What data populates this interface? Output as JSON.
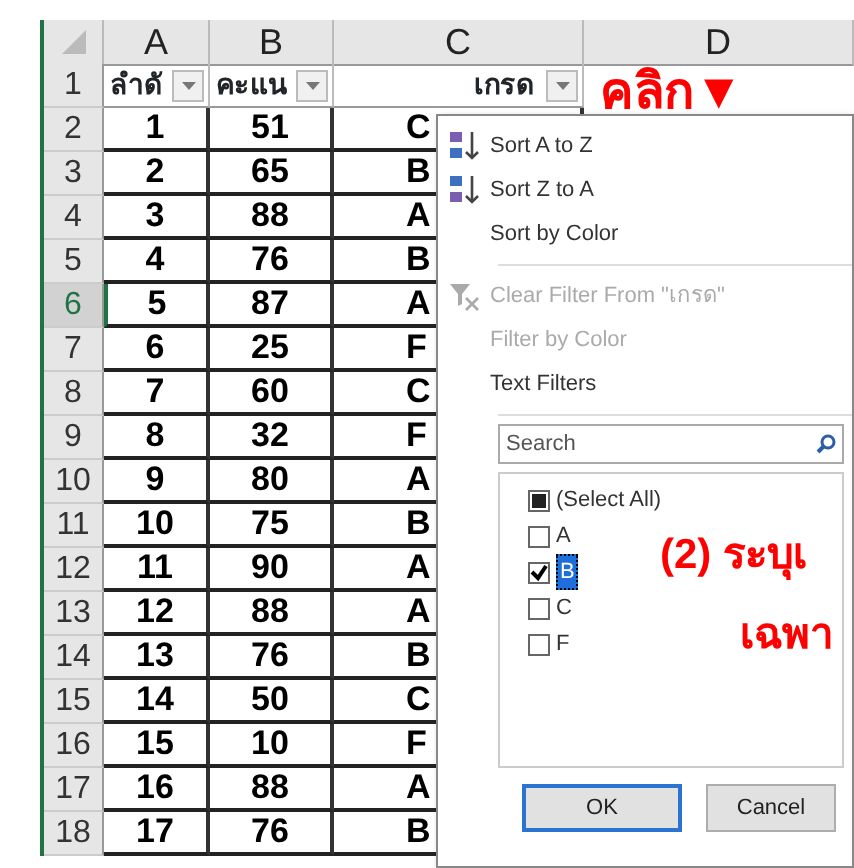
{
  "columns": [
    "A",
    "B",
    "C",
    "D"
  ],
  "header_row": {
    "number": "1",
    "cells": [
      "ลำดั",
      "คะแน",
      "เกรด"
    ]
  },
  "rows": [
    {
      "number": "2",
      "cells": [
        "1",
        "51",
        "C"
      ],
      "selected": false
    },
    {
      "number": "3",
      "cells": [
        "2",
        "65",
        "B"
      ],
      "selected": false
    },
    {
      "number": "4",
      "cells": [
        "3",
        "88",
        "A"
      ],
      "selected": false
    },
    {
      "number": "5",
      "cells": [
        "4",
        "76",
        "B"
      ],
      "selected": false
    },
    {
      "number": "6",
      "cells": [
        "5",
        "87",
        "A"
      ],
      "selected": true
    },
    {
      "number": "7",
      "cells": [
        "6",
        "25",
        "F"
      ],
      "selected": false
    },
    {
      "number": "8",
      "cells": [
        "7",
        "60",
        "C"
      ],
      "selected": false
    },
    {
      "number": "9",
      "cells": [
        "8",
        "32",
        "F"
      ],
      "selected": false
    },
    {
      "number": "10",
      "cells": [
        "9",
        "80",
        "A"
      ],
      "selected": false
    },
    {
      "number": "11",
      "cells": [
        "10",
        "75",
        "B"
      ],
      "selected": false
    },
    {
      "number": "12",
      "cells": [
        "11",
        "90",
        "A"
      ],
      "selected": false
    },
    {
      "number": "13",
      "cells": [
        "12",
        "88",
        "A"
      ],
      "selected": false
    },
    {
      "number": "14",
      "cells": [
        "13",
        "76",
        "B"
      ],
      "selected": false
    },
    {
      "number": "15",
      "cells": [
        "14",
        "50",
        "C"
      ],
      "selected": false
    },
    {
      "number": "16",
      "cells": [
        "15",
        "10",
        "F"
      ],
      "selected": false
    },
    {
      "number": "17",
      "cells": [
        "16",
        "88",
        "A"
      ],
      "selected": false
    },
    {
      "number": "18",
      "cells": [
        "17",
        "76",
        "B"
      ],
      "selected": false
    }
  ],
  "filter_menu": {
    "items": [
      {
        "kind": "sort-asc",
        "label": "Sort A to Z",
        "disabled": false
      },
      {
        "kind": "sort-desc",
        "label": "Sort Z to A",
        "disabled": false
      },
      {
        "kind": "plain",
        "label": "Sort by Color",
        "disabled": false
      },
      {
        "kind": "separator"
      },
      {
        "kind": "clear",
        "label": "Clear Filter From \"เกรด\"",
        "disabled": true
      },
      {
        "kind": "plain",
        "label": "Filter by Color",
        "disabled": true
      },
      {
        "kind": "plain",
        "label": "Text Filters",
        "disabled": false
      },
      {
        "kind": "separator"
      }
    ],
    "search": {
      "placeholder": "Search"
    },
    "options": [
      {
        "label": "(Select All)",
        "checked": true,
        "partial": true,
        "selected": false
      },
      {
        "label": "A",
        "checked": false,
        "selected": false
      },
      {
        "label": "B",
        "checked": true,
        "selected": true
      },
      {
        "label": "C",
        "checked": false,
        "selected": false
      },
      {
        "label": "F",
        "checked": false,
        "selected": false
      }
    ],
    "buttons": [
      {
        "label": "OK",
        "default": true
      },
      {
        "label": "Cancel",
        "default": false
      }
    ]
  },
  "annotations": [
    "คลิก▼",
    "(2) ระบุเ",
    "เฉพา"
  ]
}
